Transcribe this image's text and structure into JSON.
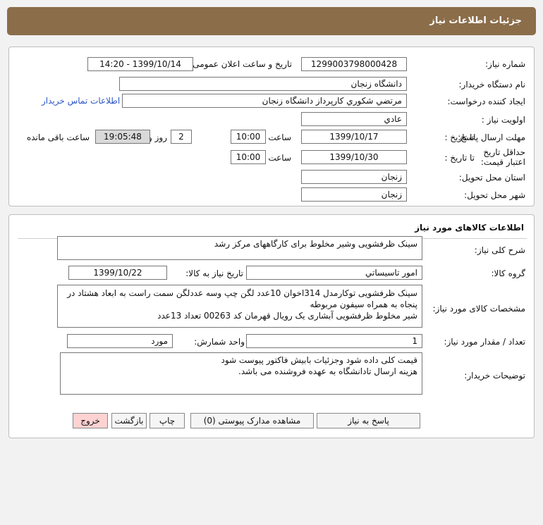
{
  "header": {
    "title": "جزئیات اطلاعات نیاز"
  },
  "need": {
    "number_label": "شماره نیاز:",
    "number": "1299003798000428",
    "announce_label": "تاریخ و ساعت اعلان عمومی:",
    "announce_value": "1399/10/14 - 14:20",
    "buyer_label": "نام دستگاه خریدار:",
    "buyer": "دانشگاه زنجان",
    "creator_label": "ایجاد کننده درخواست:",
    "creator": "مرتضي شكوري كارپرداز دانشگاه زنجان",
    "contact_link": "اطلاعات تماس خریدار",
    "priority_label": "اولویت نیاز :",
    "priority": "عادي",
    "reply_label": "مهلت ارسال پاسخ:",
    "until_label": "تا تاریخ :",
    "reply_date": "1399/10/17",
    "time_label": "ساعت",
    "reply_time": "10:00",
    "days": "2",
    "days_label": "روز و",
    "remaining_time": "19:05:48",
    "remaining_label": "ساعت باقی مانده",
    "validity_label": "حداقل تاریخ اعتبار قیمت:",
    "validity_date": "1399/10/30",
    "validity_time": "10:00",
    "province_label": "استان محل تحویل:",
    "province": "زنجان",
    "city_label": "شهر محل تحویل:",
    "city": "زنجان"
  },
  "goods": {
    "section_title": "اطلاعات کالاهای مورد نیاز",
    "desc_label": "شرح کلی نیاز:",
    "desc": "سینک ظرفشویی وشیر مخلوط برای کارگاههای مرکز رشد",
    "group_label": "گروه کالا:",
    "group": "امور تاسیساتي",
    "need_date_label": "تاریخ نیاز به کالا:",
    "need_date": "1399/10/22",
    "spec_label": "مشخصات کالای مورد نیاز:",
    "spec_lines": [
      "سینک ظرفشویی توکارمدل 314اخوان 10عدد لگن چپ وسه عددلگن سمت راست به ابعاد هشتاد در",
      "پنجاه به همراه سیفون مربوطه",
      "شیر مخلوط ظرفشویی آبشاری یک رویال قهرمان کد 00263   تعداد 13عدد"
    ],
    "qty_label": "تعداد / مقدار مورد نیاز:",
    "qty": "1",
    "unit_label": "واحد شمارش:",
    "unit": "مورد",
    "notes_label": "توضیحات خریدار:",
    "notes_lines": [
      "قیمت کلی داده شود وجزئیات بابیش فاکتور پیوست شود",
      "هزینه ارسال تادانشگاه به عهده فروشنده می باشد."
    ]
  },
  "buttons": {
    "reply": "پاسخ به نیاز",
    "attachments": "مشاهده مدارک پیوستی (0)",
    "print": "چاپ",
    "back": "بازگشت",
    "exit": "خروج"
  }
}
